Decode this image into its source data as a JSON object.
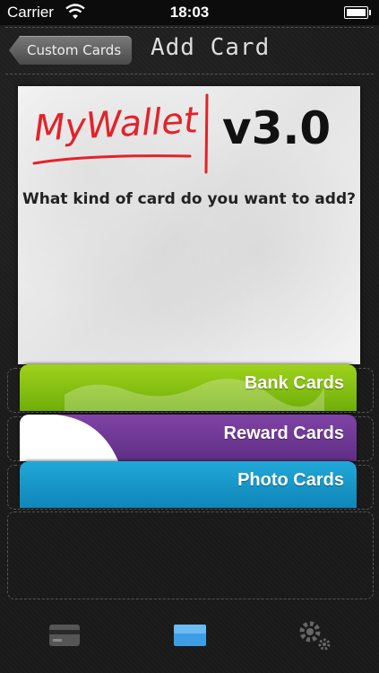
{
  "status_bar": {
    "carrier": "Carrier",
    "time": "18:03"
  },
  "nav": {
    "back_label": "Custom Cards",
    "title": "Add Card"
  },
  "header_panel": {
    "logo": "MyWallet",
    "version": "v3.0",
    "question": "What kind of card do you want to add?"
  },
  "cards": [
    {
      "label": "Bank Cards",
      "color": "#8cc414"
    },
    {
      "label": "Reward Cards",
      "color": "#6f3896"
    },
    {
      "label": "Photo Cards",
      "color": "#1a9bcc"
    }
  ],
  "tabbar": {
    "tabs": [
      {
        "icon": "card-icon",
        "selected": false
      },
      {
        "icon": "blue-card-icon",
        "selected": true
      },
      {
        "icon": "gear-icon",
        "selected": false
      }
    ]
  },
  "colors": {
    "accent_red": "#e3222a",
    "background": "#1b1b1b"
  }
}
